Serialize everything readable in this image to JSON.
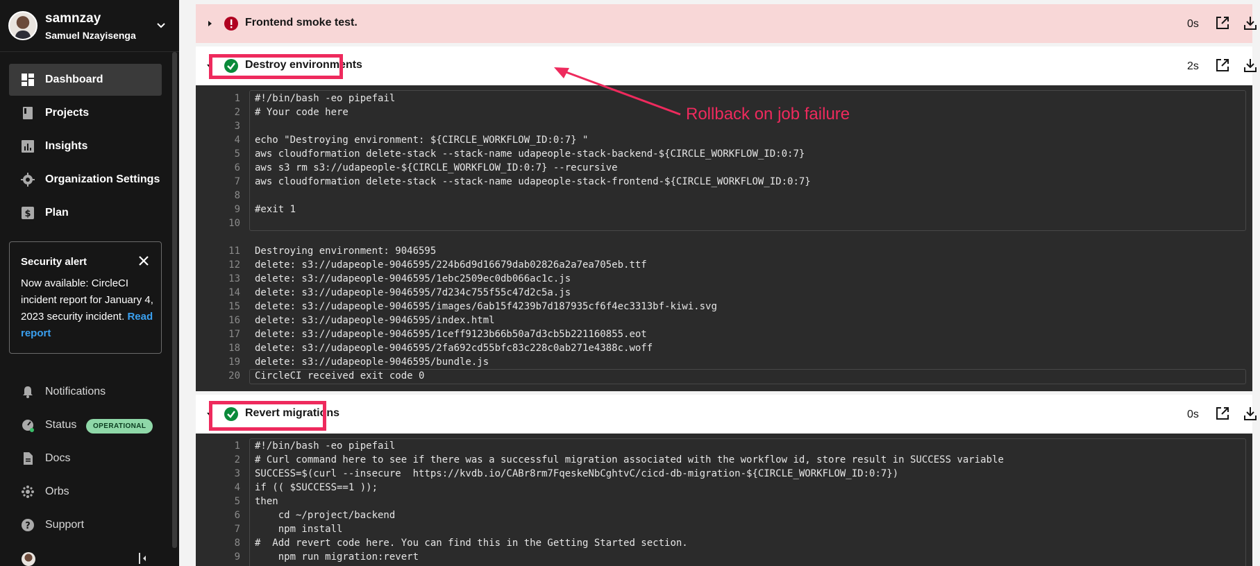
{
  "user": {
    "username": "samnzay",
    "full_name": "Samuel Nzayisenga"
  },
  "nav": [
    {
      "label": "Dashboard",
      "icon": "dashboard-icon"
    },
    {
      "label": "Projects",
      "icon": "book-icon"
    },
    {
      "label": "Insights",
      "icon": "chart-icon"
    },
    {
      "label": "Organization Settings",
      "icon": "gear-icon"
    },
    {
      "label": "Plan",
      "icon": "dollar-icon"
    }
  ],
  "security_alert": {
    "title": "Security alert",
    "body": "Now available: CircleCI incident report for January 4, 2023 security incident.",
    "link": "Read report"
  },
  "bottom_nav": [
    {
      "label": "Notifications",
      "icon": "bell-icon"
    },
    {
      "label": "Status",
      "icon": "gauge-icon"
    },
    {
      "label": "Docs",
      "icon": "document-icon"
    },
    {
      "label": "Orbs",
      "icon": "orb-icon"
    },
    {
      "label": "Support",
      "icon": "help-icon"
    }
  ],
  "status_badge": "OPERATIONAL",
  "steps": [
    {
      "title": "Frontend smoke test.",
      "duration": "0s",
      "status": "failed"
    },
    {
      "title": "Destroy environments",
      "duration": "2s",
      "status": "success"
    },
    {
      "title": "Revert migrations",
      "duration": "0s",
      "status": "success"
    }
  ],
  "destroy_script": [
    {
      "n": "1",
      "text": "#!/bin/bash -eo pipefail"
    },
    {
      "n": "2",
      "text": "# Your code here"
    },
    {
      "n": "3",
      "text": ""
    },
    {
      "n": "4",
      "text": "echo \"Destroying environment: ${CIRCLE_WORKFLOW_ID:0:7} \""
    },
    {
      "n": "5",
      "text": "aws cloudformation delete-stack --stack-name udapeople-stack-backend-${CIRCLE_WORKFLOW_ID:0:7}"
    },
    {
      "n": "6",
      "text": "aws s3 rm s3://udapeople-${CIRCLE_WORKFLOW_ID:0:7} --recursive"
    },
    {
      "n": "7",
      "text": "aws cloudformation delete-stack --stack-name udapeople-stack-frontend-${CIRCLE_WORKFLOW_ID:0:7}"
    },
    {
      "n": "8",
      "text": ""
    },
    {
      "n": "9",
      "text": "#exit 1"
    },
    {
      "n": "10",
      "text": ""
    }
  ],
  "destroy_output": [
    {
      "n": "11",
      "text": "Destroying environment: 9046595"
    },
    {
      "n": "12",
      "text": "delete: s3://udapeople-9046595/224b6d9d16679dab02826a2a7ea705eb.ttf"
    },
    {
      "n": "13",
      "text": "delete: s3://udapeople-9046595/1ebc2509ec0db066ac1c.js"
    },
    {
      "n": "14",
      "text": "delete: s3://udapeople-9046595/7d234c755f55c47d2c5a.js"
    },
    {
      "n": "15",
      "text": "delete: s3://udapeople-9046595/images/6ab15f4239b7d187935cf6f4ec3313bf-kiwi.svg"
    },
    {
      "n": "16",
      "text": "delete: s3://udapeople-9046595/index.html"
    },
    {
      "n": "17",
      "text": "delete: s3://udapeople-9046595/1ceff9123b66b50a7d3cb5b221160855.eot"
    },
    {
      "n": "18",
      "text": "delete: s3://udapeople-9046595/2fa692cd55bfc83c228c0ab271e4388c.woff"
    },
    {
      "n": "19",
      "text": "delete: s3://udapeople-9046595/bundle.js"
    },
    {
      "n": "20",
      "text": "CircleCI received exit code 0"
    }
  ],
  "revert_script": [
    {
      "n": "1",
      "text": "#!/bin/bash -eo pipefail"
    },
    {
      "n": "2",
      "text": "# Curl command here to see if there was a successful migration associated with the workflow id, store result in SUCCESS variable"
    },
    {
      "n": "3",
      "text": "SUCCESS=$(curl --insecure  https://kvdb.io/CABr8rm7FqeskeNbCghtvC/cicd-db-migration-${CIRCLE_WORKFLOW_ID:0:7})"
    },
    {
      "n": "4",
      "text": "if (( $SUCCESS==1 ));"
    },
    {
      "n": "5",
      "text": "then"
    },
    {
      "n": "6",
      "text": "    cd ~/project/backend"
    },
    {
      "n": "7",
      "text": "    npm install"
    },
    {
      "n": "8",
      "text": "#  Add revert code here. You can find this in the Getting Started section."
    },
    {
      "n": "9",
      "text": "    npm run migration:revert"
    }
  ],
  "annotation": "Rollback on job failure",
  "colors": {
    "sidebar": "#161616",
    "highlight": "#ee2a5d",
    "success": "#0a8a3a",
    "failed": "#b00020",
    "code_bg": "#2b2b2b"
  }
}
